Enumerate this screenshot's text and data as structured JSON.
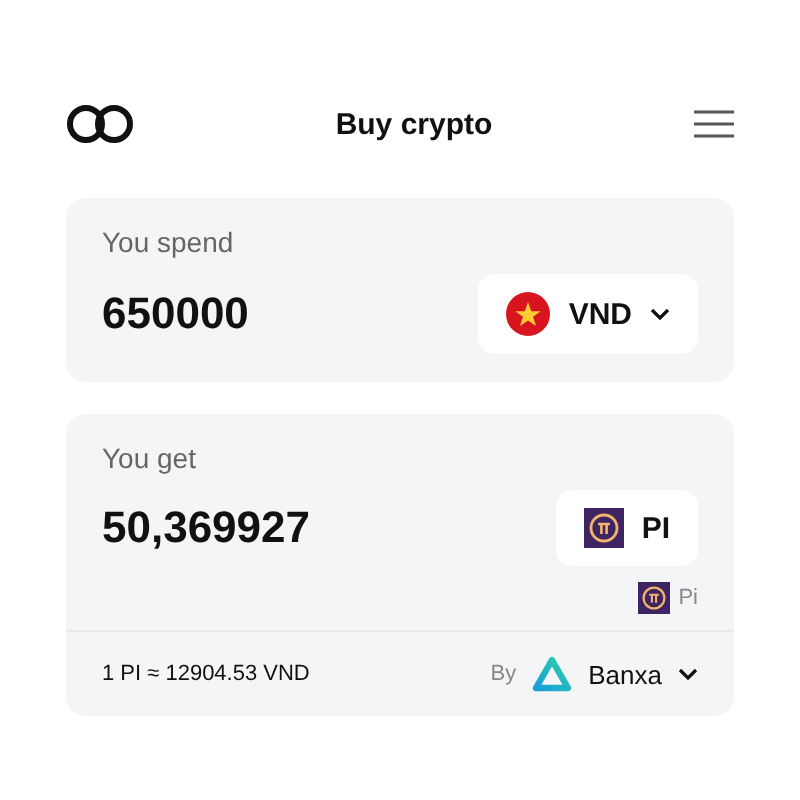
{
  "header": {
    "title": "Buy crypto"
  },
  "spend": {
    "label": "You spend",
    "amount": "650000",
    "currency": "VND"
  },
  "get": {
    "label": "You get",
    "amount": "50,369927",
    "currency": "PI",
    "network": "Pi"
  },
  "footer": {
    "rate": "1 PI ≈ 12904.53 VND",
    "by": "By",
    "provider": "Banxa"
  }
}
